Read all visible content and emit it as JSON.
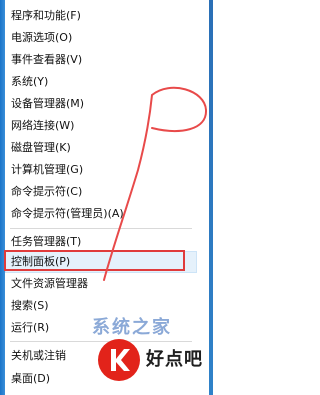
{
  "menu": {
    "items": [
      {
        "label": "程序和功能(F)"
      },
      {
        "label": "电源选项(O)"
      },
      {
        "label": "事件查看器(V)"
      },
      {
        "label": "系统(Y)"
      },
      {
        "label": "设备管理器(M)"
      },
      {
        "label": "网络连接(W)"
      },
      {
        "label": "磁盘管理(K)"
      },
      {
        "label": "计算机管理(G)"
      },
      {
        "label": "命令提示符(C)"
      },
      {
        "label": "命令提示符(管理员)(A)"
      },
      {
        "label": "任务管理器(T)"
      },
      {
        "label": "控制面板(P)"
      },
      {
        "label": "文件资源管理器"
      },
      {
        "label": "搜索(S)"
      },
      {
        "label": "运行(R)"
      },
      {
        "label": "关机或注销"
      },
      {
        "label": "桌面(D)"
      }
    ]
  },
  "watermark": {
    "faded_text": "系统之家",
    "site_text": "好点吧"
  },
  "colors": {
    "highlight_box": "#e03b3b",
    "annotation": "#e84a4a",
    "accent": "#1a73c8"
  }
}
